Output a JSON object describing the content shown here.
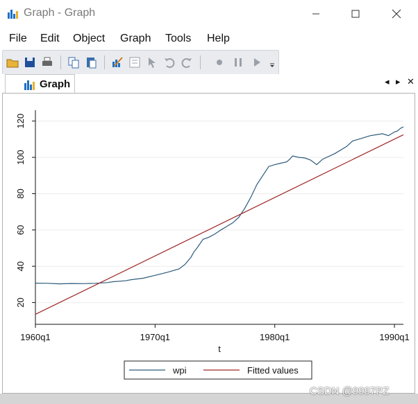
{
  "window": {
    "title": "Graph - Graph",
    "controls": {
      "minimize": "minimize",
      "maximize": "maximize",
      "close": "close"
    }
  },
  "menu": {
    "items": [
      "File",
      "Edit",
      "Object",
      "Graph",
      "Tools",
      "Help"
    ]
  },
  "toolbar": {
    "icons": [
      "open-icon",
      "save-icon",
      "print-icon",
      "copy-icon",
      "paste-icon",
      "graph-editor-icon",
      "sidebar-icon",
      "pointer-icon",
      "undo-icon",
      "redo-icon",
      "record-icon",
      "pause-icon",
      "play-icon",
      "more-icon"
    ]
  },
  "tab": {
    "label": "Graph"
  },
  "tab_controls": {
    "prev": "◂",
    "next": "▸",
    "close": "✕"
  },
  "watermark": "CSDN @9997PZ",
  "colors": {
    "wpi": "#2c5a7b",
    "fitted": "#a02626"
  },
  "chart_data": {
    "type": "line",
    "xlabel": "t",
    "ylabel": "",
    "x_ticks": [
      "1960q1",
      "1970q1",
      "1980q1",
      "1990q1"
    ],
    "x_tick_values": [
      0,
      40,
      80,
      120
    ],
    "y_ticks": [
      20,
      40,
      60,
      80,
      100,
      120
    ],
    "xlim": [
      0,
      123
    ],
    "ylim": [
      8,
      126
    ],
    "grid": "horizontal",
    "legend": "bottom",
    "series": [
      {
        "name": "wpi",
        "x": [
          0,
          4,
          8,
          12,
          16,
          20,
          24,
          26,
          30,
          32,
          36,
          40,
          44,
          48,
          50,
          52,
          53,
          54,
          56,
          58,
          60,
          62,
          64,
          66,
          68,
          70,
          72,
          74,
          76,
          78,
          80,
          82,
          84,
          85,
          86,
          88,
          90,
          92,
          94,
          96,
          100,
          104,
          106,
          108,
          110,
          112,
          114,
          116,
          118,
          120,
          121,
          122,
          123
        ],
        "y": [
          30.7,
          30.6,
          30.3,
          30.5,
          30.4,
          30.6,
          31.0,
          31.5,
          32.0,
          32.6,
          33.4,
          35.0,
          36.6,
          38.5,
          41.0,
          45.0,
          48.0,
          50.0,
          54.8,
          56.0,
          57.8,
          60.0,
          62.0,
          64.0,
          67.0,
          72.0,
          78.0,
          85.0,
          90.0,
          95.0,
          96.0,
          96.8,
          97.5,
          99.0,
          100.8,
          100.0,
          99.7,
          98.5,
          96.0,
          99.0,
          102.0,
          106.0,
          109.0,
          110.0,
          111.0,
          112.0,
          112.5,
          113.0,
          112.0,
          114.0,
          114.5,
          116.0,
          116.8
        ]
      },
      {
        "name": "Fitted values",
        "x": [
          0,
          123
        ],
        "y": [
          13.5,
          112.5
        ]
      }
    ]
  }
}
